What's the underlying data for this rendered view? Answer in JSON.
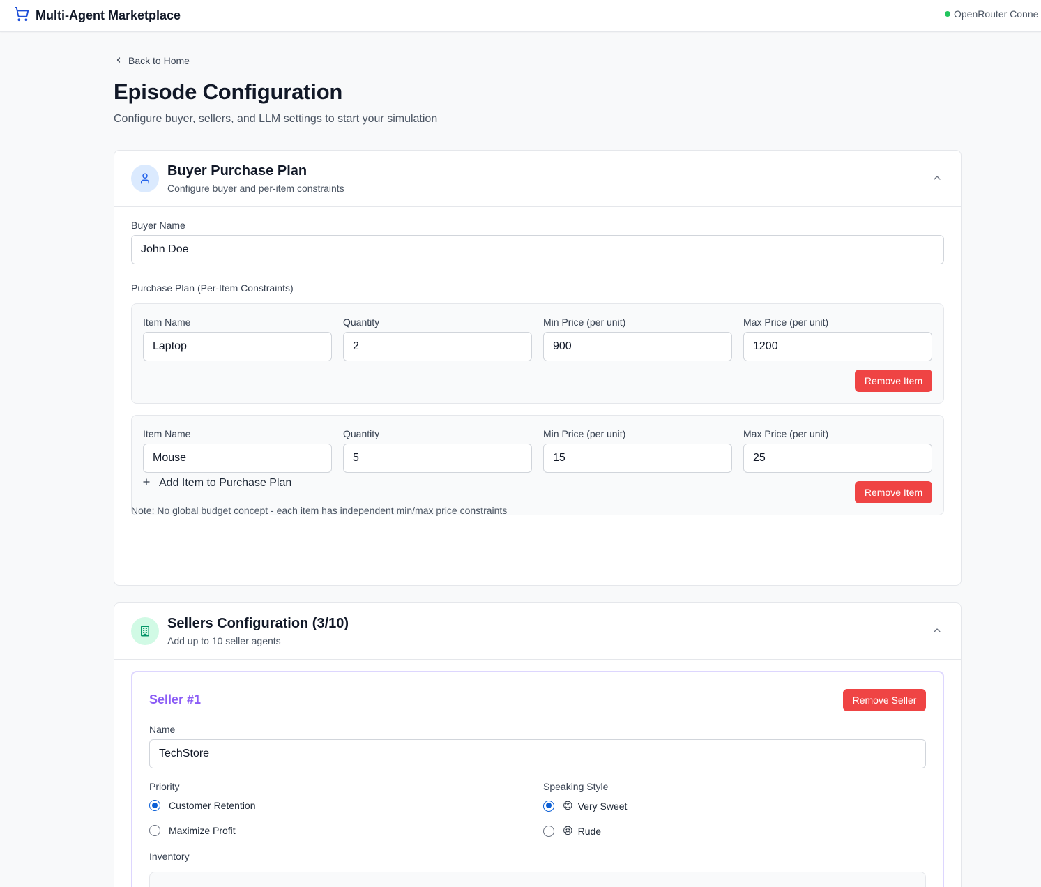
{
  "header": {
    "app_title": "Multi-Agent Marketplace",
    "cart_icon": "shopping-cart-icon",
    "status_text": "OpenRouter Conne",
    "status_color": "#22c55e"
  },
  "nav": {
    "back_label": "Back to Home"
  },
  "page": {
    "title": "Episode Configuration",
    "subtitle": "Configure buyer, sellers, and LLM settings to start your simulation"
  },
  "buyer_section": {
    "title": "Buyer Purchase Plan",
    "subtitle": "Configure buyer and per-item constraints",
    "icon": "user-icon",
    "buyer_name_label": "Buyer Name",
    "buyer_name_value": "John Doe",
    "purchase_plan_label": "Purchase Plan (Per-Item Constraints)",
    "columns": [
      "Item Name",
      "Quantity",
      "Min Price (per unit)",
      "Max Price (per unit)"
    ],
    "items": [
      {
        "name": "Laptop",
        "quantity": "2",
        "min_price": "900",
        "max_price": "1200",
        "remove_label": "Remove Item"
      },
      {
        "name": "Mouse",
        "quantity": "5",
        "min_price": "15",
        "max_price": "25",
        "remove_label": "Remove Item"
      }
    ],
    "add_item_label": "Add Item to Purchase Plan",
    "note": "Note: No global budget concept - each item has independent min/max price constraints"
  },
  "sellers_section": {
    "title": "Sellers Configuration (3/10)",
    "subtitle": "Add up to 10 seller agents",
    "icon": "building-icon",
    "sellers": [
      {
        "title": "Seller #1",
        "remove_label": "Remove Seller",
        "name_label": "Name",
        "name_value": "TechStore",
        "priority_label": "Priority",
        "priority_options": [
          "Customer Retention",
          "Maximize Profit"
        ],
        "priority_selected": "Customer Retention",
        "style_label": "Speaking Style",
        "style_options": [
          {
            "emoji": "😊",
            "label": "Very Sweet"
          },
          {
            "emoji": "😡",
            "label": "Rude"
          }
        ],
        "style_selected": "Very Sweet",
        "inventory_label": "Inventory"
      }
    ]
  },
  "colors": {
    "danger": "#ef4444",
    "accent_purple": "#8b5cf6",
    "radio_blue": "#0b5fd6",
    "buyer_icon_bg": "#dbeafe",
    "seller_icon_bg": "#d1fae5"
  }
}
